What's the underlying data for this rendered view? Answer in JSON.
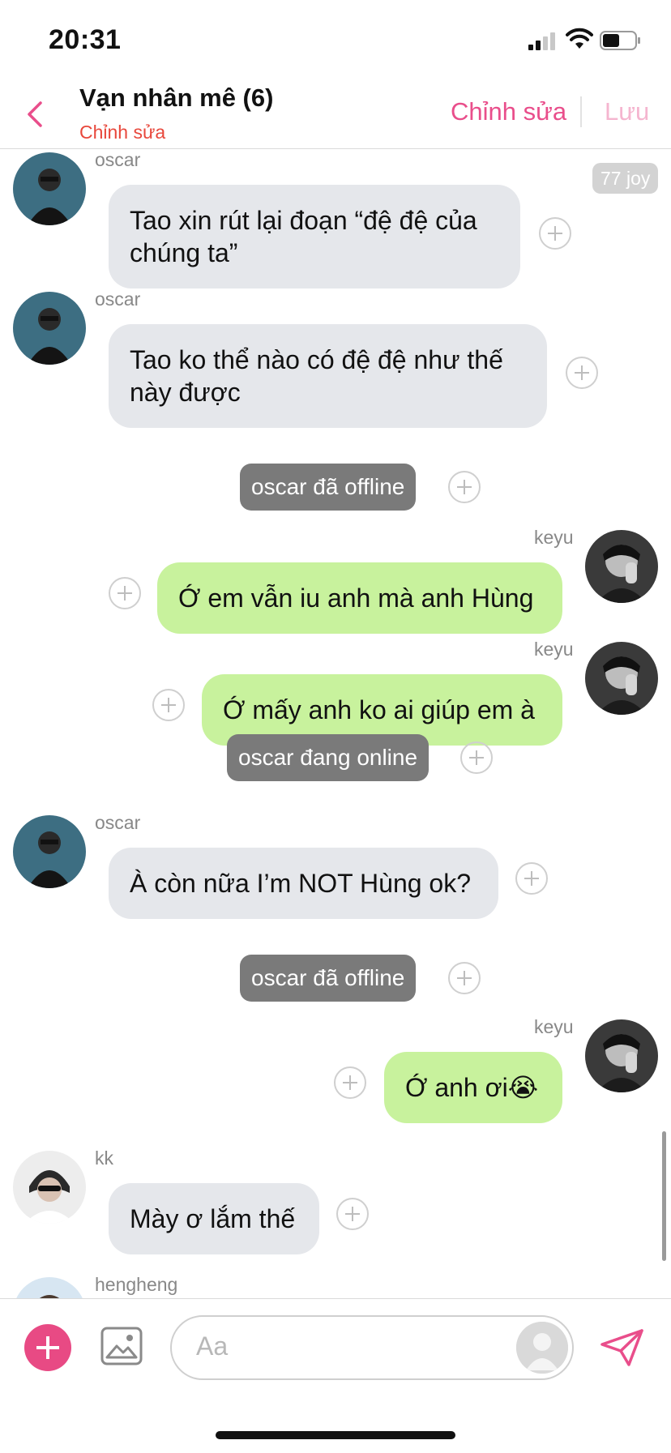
{
  "status_bar": {
    "time": "20:31"
  },
  "header": {
    "title": "Vạn nhân mê (6)",
    "subtitle": "Chỉnh sửa",
    "edit_label": "Chỉnh sửa",
    "save_label": "Lưu"
  },
  "chat": {
    "tag": "77 joy",
    "messages": [
      {
        "sender": "oscar",
        "text": "Tao xin rút lại đoạn “đệ đệ của chúng ta”"
      },
      {
        "sender": "oscar",
        "text": "Tao ko thể nào có đệ đệ như thế này được"
      },
      {
        "system": "oscar đã offline"
      },
      {
        "sender": "keyu",
        "text": "Ớ em vẫn iu anh mà anh Hùng"
      },
      {
        "sender": "keyu",
        "text": "Ớ mấy anh ko ai giúp em à"
      },
      {
        "system": "oscar đang online"
      },
      {
        "sender": "oscar",
        "text": "À còn nữa I’m NOT Hùng ok?"
      },
      {
        "system": "oscar đã offline"
      },
      {
        "sender": "keyu",
        "text": "Ớ anh ơi😭"
      },
      {
        "sender": "kk",
        "text": "Mày ơ lắm thế"
      },
      {
        "sender": "hengheng",
        "text": ""
      }
    ]
  },
  "input_bar": {
    "placeholder": "Aa"
  },
  "colors": {
    "accent": "#e94e8b",
    "outgoing_bubble": "#c8f29d",
    "incoming_bubble": "#e5e7eb",
    "system_pill": "#7a7a7a"
  }
}
